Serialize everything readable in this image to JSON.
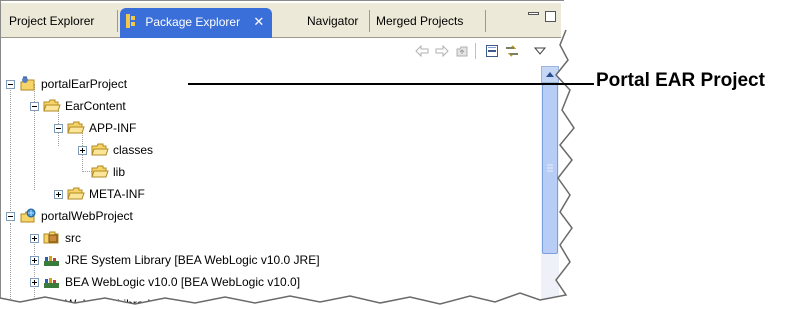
{
  "tabs": [
    {
      "label": "Project Explorer",
      "active": false
    },
    {
      "label": "Package Explorer",
      "active": true,
      "close_glyph": "✕"
    },
    {
      "label": "Navigator",
      "active": false
    },
    {
      "label": "Merged Projects",
      "active": false
    }
  ],
  "toolbar": {
    "buttons": [
      "back-arrow-icon",
      "forward-arrow-icon",
      "up-folder-icon",
      "collapse-all-icon",
      "link-with-editor-icon",
      "view-menu-icon"
    ]
  },
  "tree": {
    "items": [
      {
        "label": "portalEarProject",
        "icon": "ear-project-icon",
        "expanded": true
      },
      {
        "label": "EarContent",
        "icon": "folder-icon",
        "expanded": true
      },
      {
        "label": "APP-INF",
        "icon": "folder-icon",
        "expanded": true
      },
      {
        "label": "classes",
        "icon": "folder-icon",
        "expanded": false
      },
      {
        "label": "lib",
        "icon": "folder-icon",
        "expanded": null
      },
      {
        "label": "META-INF",
        "icon": "folder-icon",
        "expanded": false
      },
      {
        "label": "portalWebProject",
        "icon": "web-project-icon",
        "expanded": true
      },
      {
        "label": "src",
        "icon": "source-folder-icon",
        "expanded": false
      },
      {
        "label": "JRE System Library [BEA WebLogic v10.0 JRE]",
        "icon": "library-icon",
        "expanded": false
      },
      {
        "label": "BEA WebLogic v10.0 [BEA WebLogic v10.0]",
        "icon": "library-icon",
        "expanded": false
      },
      {
        "label": "Web App Libraries",
        "icon": "library-icon",
        "expanded": false
      }
    ]
  },
  "callout": {
    "label": "Portal EAR Project"
  },
  "colors": {
    "active_tab": "#3a6ed8",
    "tab_strip": "#ece9d8",
    "folder": "#f6d468",
    "scroll_thumb": "#b8cdf5"
  }
}
